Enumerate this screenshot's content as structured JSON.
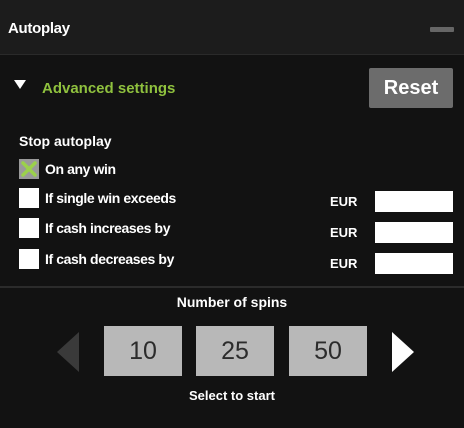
{
  "window": {
    "title": "Autoplay",
    "minimize_icon": "minimize-icon"
  },
  "advanced": {
    "label": "Advanced settings",
    "icon": "triangle-down-icon",
    "accent": "#8fc13e"
  },
  "reset_label": "Reset",
  "stop": {
    "title": "Stop autoplay",
    "options": [
      {
        "label": "On any win",
        "checked": true
      },
      {
        "label": "If single win exceeds",
        "checked": false,
        "currency": "EUR",
        "value": ""
      },
      {
        "label": "If cash increases by",
        "checked": false,
        "currency": "EUR",
        "value": ""
      },
      {
        "label": "If cash decreases by",
        "checked": false,
        "currency": "EUR",
        "value": ""
      }
    ]
  },
  "spins": {
    "title": "Number of spins",
    "options": [
      "10",
      "25",
      "50"
    ],
    "hint": "Select to start",
    "prev_icon": "arrow-left-icon",
    "next_icon": "arrow-right-icon"
  }
}
